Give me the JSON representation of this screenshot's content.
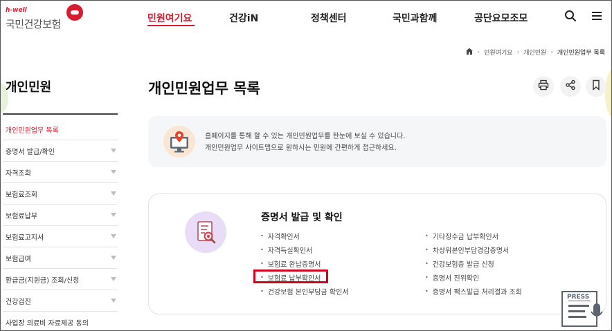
{
  "logo": {
    "tagline": "h-well",
    "name": "국민건강보험"
  },
  "gnb": [
    {
      "label": "민원여기요",
      "active": true
    },
    {
      "label": "건강iN",
      "active": false
    },
    {
      "label": "정책센터",
      "active": false
    },
    {
      "label": "국민과함께",
      "active": false
    },
    {
      "label": "공단요모조모",
      "active": false
    }
  ],
  "header_icons": [
    "search-icon",
    "menu-icon"
  ],
  "breadcrumb": {
    "home_icon": "home-icon",
    "items": [
      "민원여기요",
      "개인민원",
      "개인민원업무 목록"
    ]
  },
  "sidebar": {
    "title": "개인민원",
    "items": [
      {
        "label": "개인민원업무 목록",
        "active": true,
        "expandable": false
      },
      {
        "label": "증명서 발급/확인",
        "active": false,
        "expandable": true
      },
      {
        "label": "자격조회",
        "active": false,
        "expandable": true
      },
      {
        "label": "보험료조회",
        "active": false,
        "expandable": true
      },
      {
        "label": "보험료납부",
        "active": false,
        "expandable": true
      },
      {
        "label": "보험료고지서",
        "active": false,
        "expandable": true
      },
      {
        "label": "보험급여",
        "active": false,
        "expandable": true
      },
      {
        "label": "환급금(지원금) 조회/신청",
        "active": false,
        "expandable": true
      },
      {
        "label": "건강검진",
        "active": false,
        "expandable": true
      },
      {
        "label": "사업장 의료비 자료제공 동의",
        "active": false,
        "expandable": false
      }
    ]
  },
  "page": {
    "title": "개인민원업무 목록",
    "tools": [
      "print-icon",
      "share-icon",
      "bookmark-icon"
    ]
  },
  "info": {
    "icon": "monitor-location-icon",
    "line1": "홈페이지를 통해 할 수 있는 개인민원업무를 한눈에 보실 수 있습니다.",
    "line2": "개인민원업무 사이트맵으로 원하시는 민원에 간편하게 접근하세요."
  },
  "certificate_card": {
    "icon": "document-search-icon",
    "title": "증명서 발급 및 확인",
    "left_links": [
      "자격확인서",
      "자격득실확인서",
      "보험료 완납증명서",
      "보험료 납부확인서",
      "건강보험 본인부담금 확인서"
    ],
    "right_links": [
      "기타징수금 납부확인서",
      "차상위본인부담경감증명서",
      "건강보험증 발급 신청",
      "증명서 진위확인",
      "증명서 팩스발급 처리결과 조회"
    ],
    "highlighted_link": "보험료 납부확인서"
  },
  "press_widget": {
    "label": "PRESS"
  },
  "colors": {
    "brand": "#d81b2f",
    "highlight": "#d0021b",
    "info_bg": "#f5f6f7"
  }
}
